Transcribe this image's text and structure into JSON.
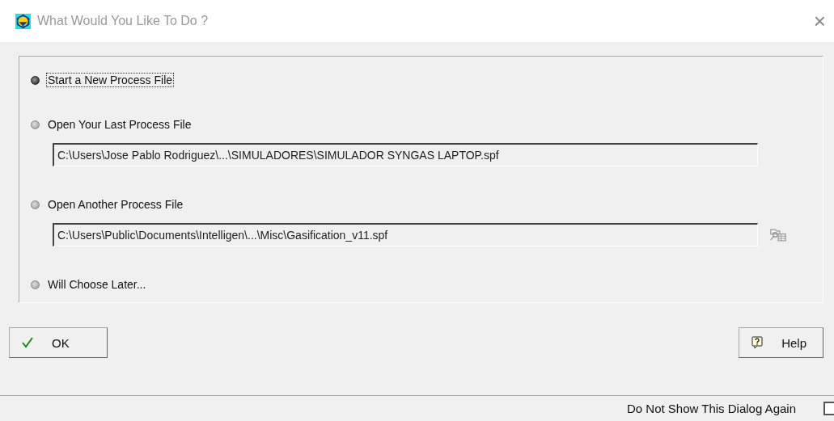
{
  "window": {
    "title": "What Would You Like To Do ?",
    "close": "×"
  },
  "options": [
    {
      "label": "Start a New Process File",
      "selected": true,
      "focused": true
    },
    {
      "label": "Open Your Last Process File",
      "selected": false,
      "focused": false,
      "field": {
        "value": "C:\\Users\\Jose Pablo Rodriguez\\...\\SIMULADORES\\SIMULADOR SYNGAS LAPTOP.spf",
        "browse": false
      }
    },
    {
      "label": "Open Another Process File",
      "selected": false,
      "focused": false,
      "field": {
        "value": "C:\\Users\\Public\\Documents\\Intelligen\\...\\Misc\\Gasification_v11.spf",
        "browse": true
      }
    },
    {
      "label": "Will Choose Later...",
      "selected": false,
      "focused": false
    }
  ],
  "buttons": [
    {
      "label": "OK",
      "kind": "ok"
    },
    {
      "label": "Help",
      "kind": "help"
    }
  ],
  "footer": {
    "label": "Do Not Show This Dialog Again",
    "checked": false
  }
}
